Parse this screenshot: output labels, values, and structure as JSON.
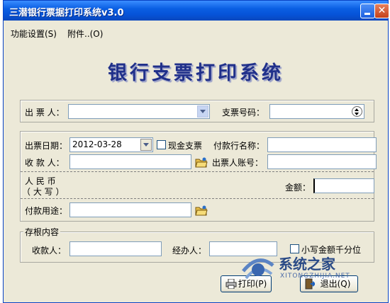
{
  "window": {
    "title": "三潜银行票据打印系统v3.0",
    "close_glyph": "✕"
  },
  "menu": {
    "settings": "功能设置(S)",
    "attachments": "附件..(O)"
  },
  "app_title": "银行支票打印系统",
  "drawer": {
    "label": "出 票 人：",
    "value": ""
  },
  "cheque_no": {
    "label": "支票号码：",
    "value": ""
  },
  "issue_date": {
    "label": "出票日期：",
    "value": "2012-03-28"
  },
  "cash_cheque": {
    "label": "现金支票",
    "checked": false
  },
  "payer_bank": {
    "label": "付款行名称：",
    "value": ""
  },
  "payee": {
    "label": "收 款 人：",
    "value": ""
  },
  "drawer_account": {
    "label": "出票人账号：",
    "value": ""
  },
  "amount_words": {
    "line1": "人 民 币",
    "line2": "（ 大 写 ）"
  },
  "amount": {
    "label": "金额：",
    "value": ""
  },
  "purpose": {
    "label": "付款用途：",
    "value": ""
  },
  "stub": {
    "legend": "存根内容",
    "payee_label": "收款人：",
    "handler_label": "经办人：",
    "lowercase_thousands": "小写金额千分位"
  },
  "buttons": {
    "print": "打印(P)",
    "exit": "退出(Q)"
  },
  "watermark": {
    "text": "系统之家",
    "sub": "XITONGZHIJIA.NET"
  }
}
